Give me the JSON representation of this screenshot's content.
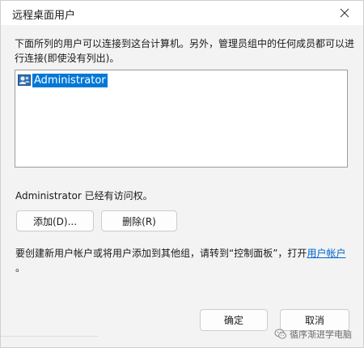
{
  "window": {
    "title": "远程桌面用户",
    "close_symbol": "✕"
  },
  "description": "下面所列的用户可以连接到这台计算机。另外，管理员组中的任何成员都可以进行连接(即使没有列出)。",
  "users": [
    {
      "name": "Administrator",
      "icon": "user-icon",
      "selected": true
    }
  ],
  "access_status": "Administrator 已经有访问权。",
  "buttons": {
    "add": "添加(D)...",
    "remove": "删除(R)",
    "ok": "确定",
    "cancel": "取消"
  },
  "hint": {
    "text": "要创建新用户帐户或将用户添加到其他组，请转到“控制面板”，打开",
    "link": "用户帐户",
    "end": "。"
  },
  "watermark": {
    "text": "循序渐进学电脑",
    "icon": "wechat-icon"
  },
  "colors": {
    "selection": "#0078d7",
    "link": "#0066cc",
    "background": "#f3f3f3"
  }
}
